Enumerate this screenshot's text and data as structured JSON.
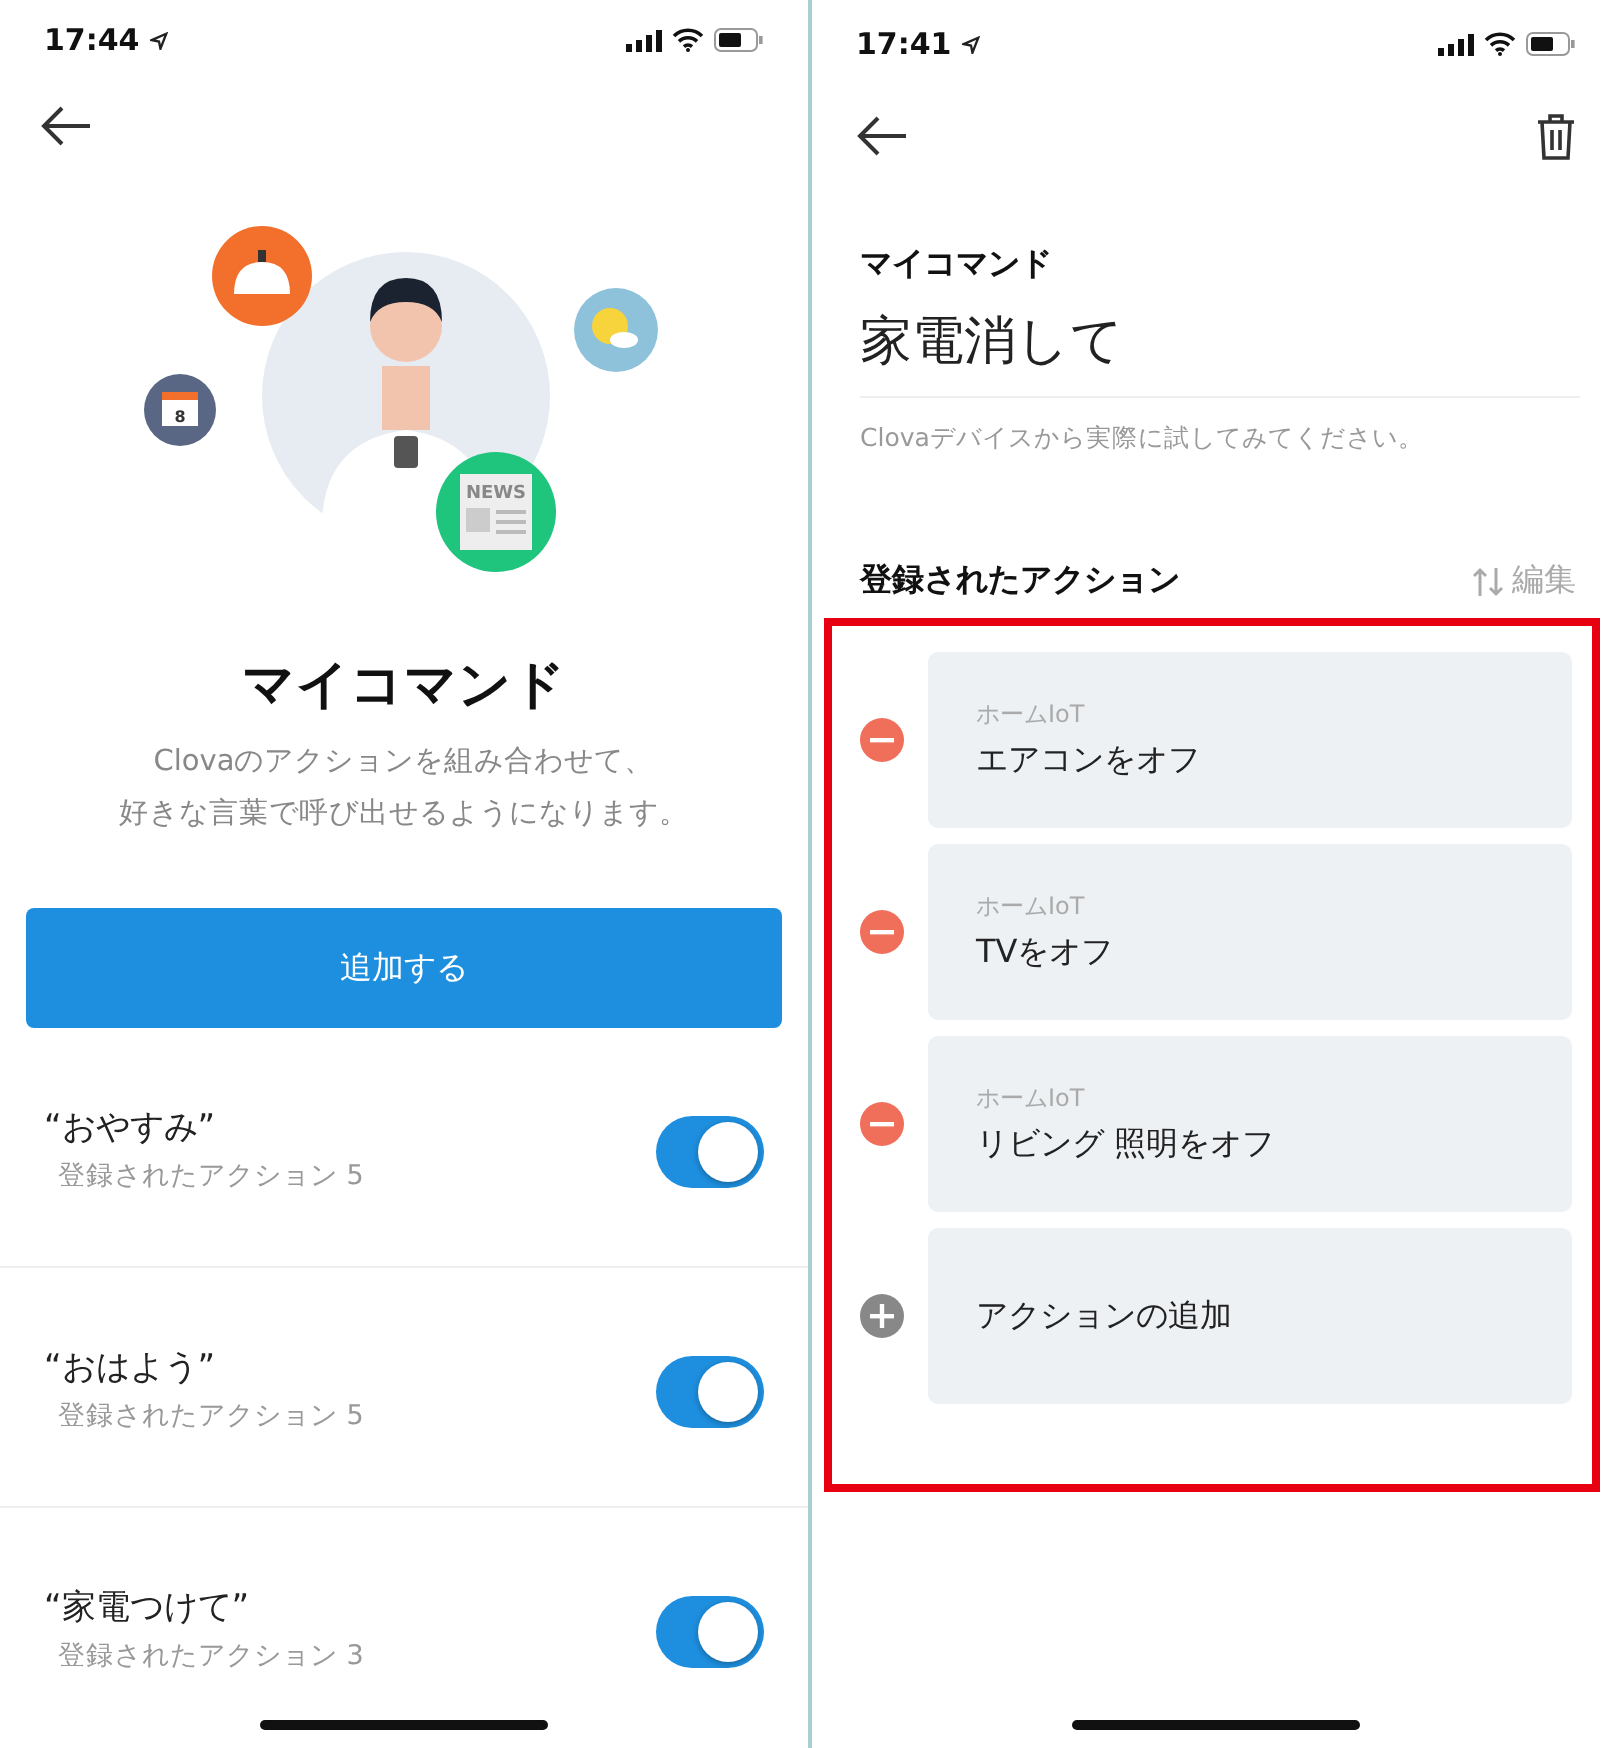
{
  "left_screen": {
    "status_bar": {
      "time": "17:44"
    },
    "illustration": {
      "news_label": "NEWS",
      "calendar_day": "8"
    },
    "title": "マイコマンド",
    "description_lines": [
      "Clovaのアクションを組み合わせて、",
      "好きな言葉で呼び出せるようになります。"
    ],
    "add_button": "追加する",
    "commands": [
      {
        "name": "“おやすみ”",
        "subtitle": "登録されたアクション 5",
        "on": true
      },
      {
        "name": "“おはよう”",
        "subtitle": "登録されたアクション 5",
        "on": true
      },
      {
        "name": "“家電つけて”",
        "subtitle": "登録されたアクション 3",
        "on": true
      }
    ]
  },
  "right_screen": {
    "status_bar": {
      "time": "17:41"
    },
    "section_label": "マイコマンド",
    "command_name": "家電消して",
    "hint": "Clovaデバイスから実際に試してみてください。",
    "actions_heading": "登録されたアクション",
    "edit_button": "編集",
    "actions_highlighted": true,
    "actions": [
      {
        "kind": "remove",
        "category": "ホームIoT",
        "label": "エアコンをオフ"
      },
      {
        "kind": "remove",
        "category": "ホームIoT",
        "label": "TVをオフ"
      },
      {
        "kind": "remove",
        "category": "ホームIoT",
        "label": "リビング 照明をオフ"
      },
      {
        "kind": "add",
        "label": "アクションの追加"
      }
    ]
  }
}
